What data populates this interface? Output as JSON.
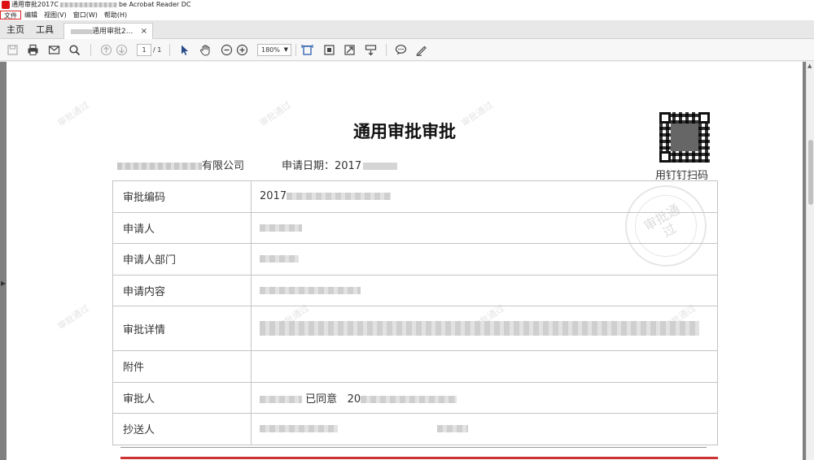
{
  "window": {
    "title_prefix": "通用审批2017C",
    "title_suffix": "be Acrobat Reader DC"
  },
  "menu": [
    {
      "label": "文件",
      "active": true
    },
    {
      "label": "编辑"
    },
    {
      "label": "视图(V)"
    },
    {
      "label": "窗口(W)"
    },
    {
      "label": "帮助(H)"
    }
  ],
  "tabs": {
    "home": "主页",
    "tools": "工具",
    "document": "通用审批2...",
    "close": "×"
  },
  "toolbar": {
    "page_current": "1",
    "page_total": "/ 1",
    "zoom": "180%",
    "zoom_arrow": "▼"
  },
  "document": {
    "title": "通用审批审批",
    "company_suffix": "有限公司",
    "apply_date_label": "申请日期：2017",
    "qr_label": "用钉钉扫码",
    "stamp_text": "审批通过",
    "watermark": "审批通过",
    "rows": [
      {
        "label": "审批编码",
        "value_prefix": "2017"
      },
      {
        "label": "申请人",
        "value_prefix": ""
      },
      {
        "label": "申请人部门",
        "value_prefix": ""
      },
      {
        "label": "申请内容",
        "value_prefix": ""
      },
      {
        "label": "审批详情",
        "value_prefix": ""
      },
      {
        "label": "附件",
        "value_prefix": ""
      },
      {
        "label": "审批人",
        "value_prefix": "",
        "value_mid": "已同意",
        "value_year": "20"
      },
      {
        "label": "抄送人",
        "value_prefix": ""
      }
    ]
  },
  "colors": {
    "accent_red": "#d22222",
    "page_bg": "#ffffff",
    "viewer_bg": "#808080"
  }
}
